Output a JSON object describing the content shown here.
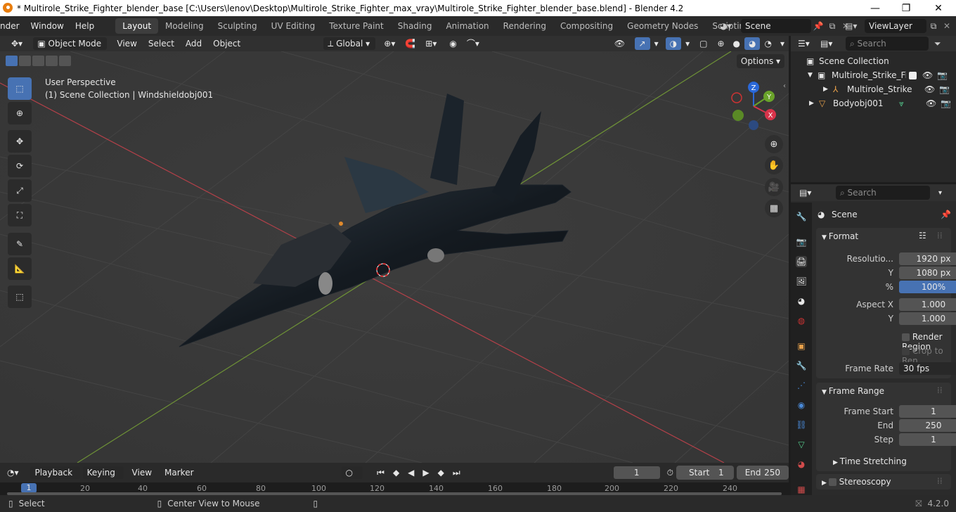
{
  "window": {
    "title": "* Multirole_Strike_Fighter_blender_base [C:\\Users\\lenov\\Desktop\\Multirole_Strike_Fighter_max_vray\\Multirole_Strike_Fighter_blender_base.blend] - Blender 4.2",
    "minimize": "—",
    "maximize": "❐",
    "close": "✕"
  },
  "menubar": {
    "items": [
      "nder",
      "Window",
      "Help"
    ]
  },
  "workspaces": {
    "tabs": [
      "Layout",
      "Modeling",
      "Sculpting",
      "UV Editing",
      "Texture Paint",
      "Shading",
      "Animation",
      "Rendering",
      "Compositing",
      "Geometry Nodes",
      "Scripting"
    ],
    "active": "Layout",
    "add": "+"
  },
  "scene_selector": {
    "value": "Scene"
  },
  "viewlayer_selector": {
    "value": "ViewLayer"
  },
  "viewport_header": {
    "mode": "Object Mode",
    "menus": [
      "View",
      "Select",
      "Add",
      "Object"
    ],
    "orientation": "Global",
    "options": "Options"
  },
  "viewport": {
    "perspective_label": "User Perspective",
    "collection_label": "(1) Scene Collection | Windshieldobj001",
    "gizmo": {
      "x": "X",
      "y": "Y",
      "z": "Z"
    }
  },
  "outliner": {
    "search_placeholder": "Search",
    "rows": [
      {
        "label": "Scene Collection"
      },
      {
        "label": "Multirole_Strike_Fig"
      },
      {
        "label": "Multirole_Strike"
      },
      {
        "label": "Bodyobj001"
      }
    ]
  },
  "properties": {
    "search_placeholder": "Search",
    "context": "Scene",
    "format": {
      "title": "Format",
      "resolution_label": "Resolutio...",
      "resolution_x": "1920 px",
      "y_label": "Y",
      "resolution_y": "1080 px",
      "pct_label": "%",
      "resolution_pct": "100%",
      "aspect_x_label": "Aspect X",
      "aspect_x": "1.000",
      "aspect_y_label": "Y",
      "aspect_y": "1.000",
      "render_region": "Render Region",
      "crop": "Crop to Ren...",
      "frame_rate_label": "Frame Rate",
      "frame_rate": "30 fps"
    },
    "frame_range": {
      "title": "Frame Range",
      "start_label": "Frame Start",
      "start": "1",
      "end_label": "End",
      "end": "250",
      "step_label": "Step",
      "step": "1",
      "time_stretching": "Time Stretching"
    },
    "stereoscopy": "Stereoscopy"
  },
  "timeline": {
    "menus": [
      "Playback",
      "Keying",
      "View",
      "Marker"
    ],
    "current_frame": "1",
    "start_label": "Start",
    "start": "1",
    "end_label": "End",
    "end": "250",
    "ruler": [
      "1",
      "20",
      "40",
      "60",
      "80",
      "100",
      "120",
      "140",
      "160",
      "180",
      "200",
      "220",
      "240"
    ]
  },
  "statusbar": {
    "select": "Select",
    "center": "Center View to Mouse",
    "version": "4.2.0"
  }
}
